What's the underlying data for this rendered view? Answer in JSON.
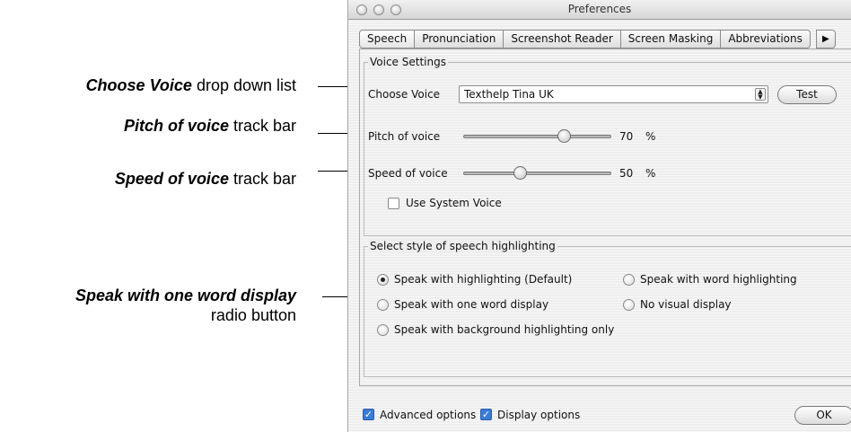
{
  "annotations": [
    {
      "bold": "Choose Voice",
      "rest": " drop down list"
    },
    {
      "bold": "Pitch of voice",
      "rest": " track bar"
    },
    {
      "bold": "Speed of voice",
      "rest": " track bar"
    },
    {
      "bold": "Speak with one word display",
      "line2": "radio button"
    }
  ],
  "window": {
    "title": "Preferences",
    "tabs": [
      "Speech",
      "Pronunciation",
      "Screenshot Reader",
      "Screen Masking",
      "Abbreviations"
    ],
    "active_tab": "Speech"
  },
  "voice_settings": {
    "legend": "Voice Settings",
    "choose_voice_label": "Choose Voice",
    "voice_value": "Texthelp Tina UK",
    "test_label": "Test",
    "pitch_label": "Pitch of voice",
    "pitch_value": "70",
    "pitch_unit": "%",
    "speed_label": "Speed of voice",
    "speed_value": "50",
    "speed_unit": "%",
    "use_system_voice_label": "Use System Voice",
    "use_system_voice_checked": false
  },
  "highlighting": {
    "legend": "Select style of speech highlighting",
    "options": [
      "Speak with highlighting (Default)",
      "Speak with word highlighting",
      "Speak with one word display",
      "No visual display",
      "Speak with background highlighting only"
    ],
    "selected_index": 0
  },
  "footer": {
    "advanced_label": "Advanced options",
    "advanced_checked": true,
    "display_label": "Display options",
    "display_checked": true,
    "ok_label": "OK"
  }
}
